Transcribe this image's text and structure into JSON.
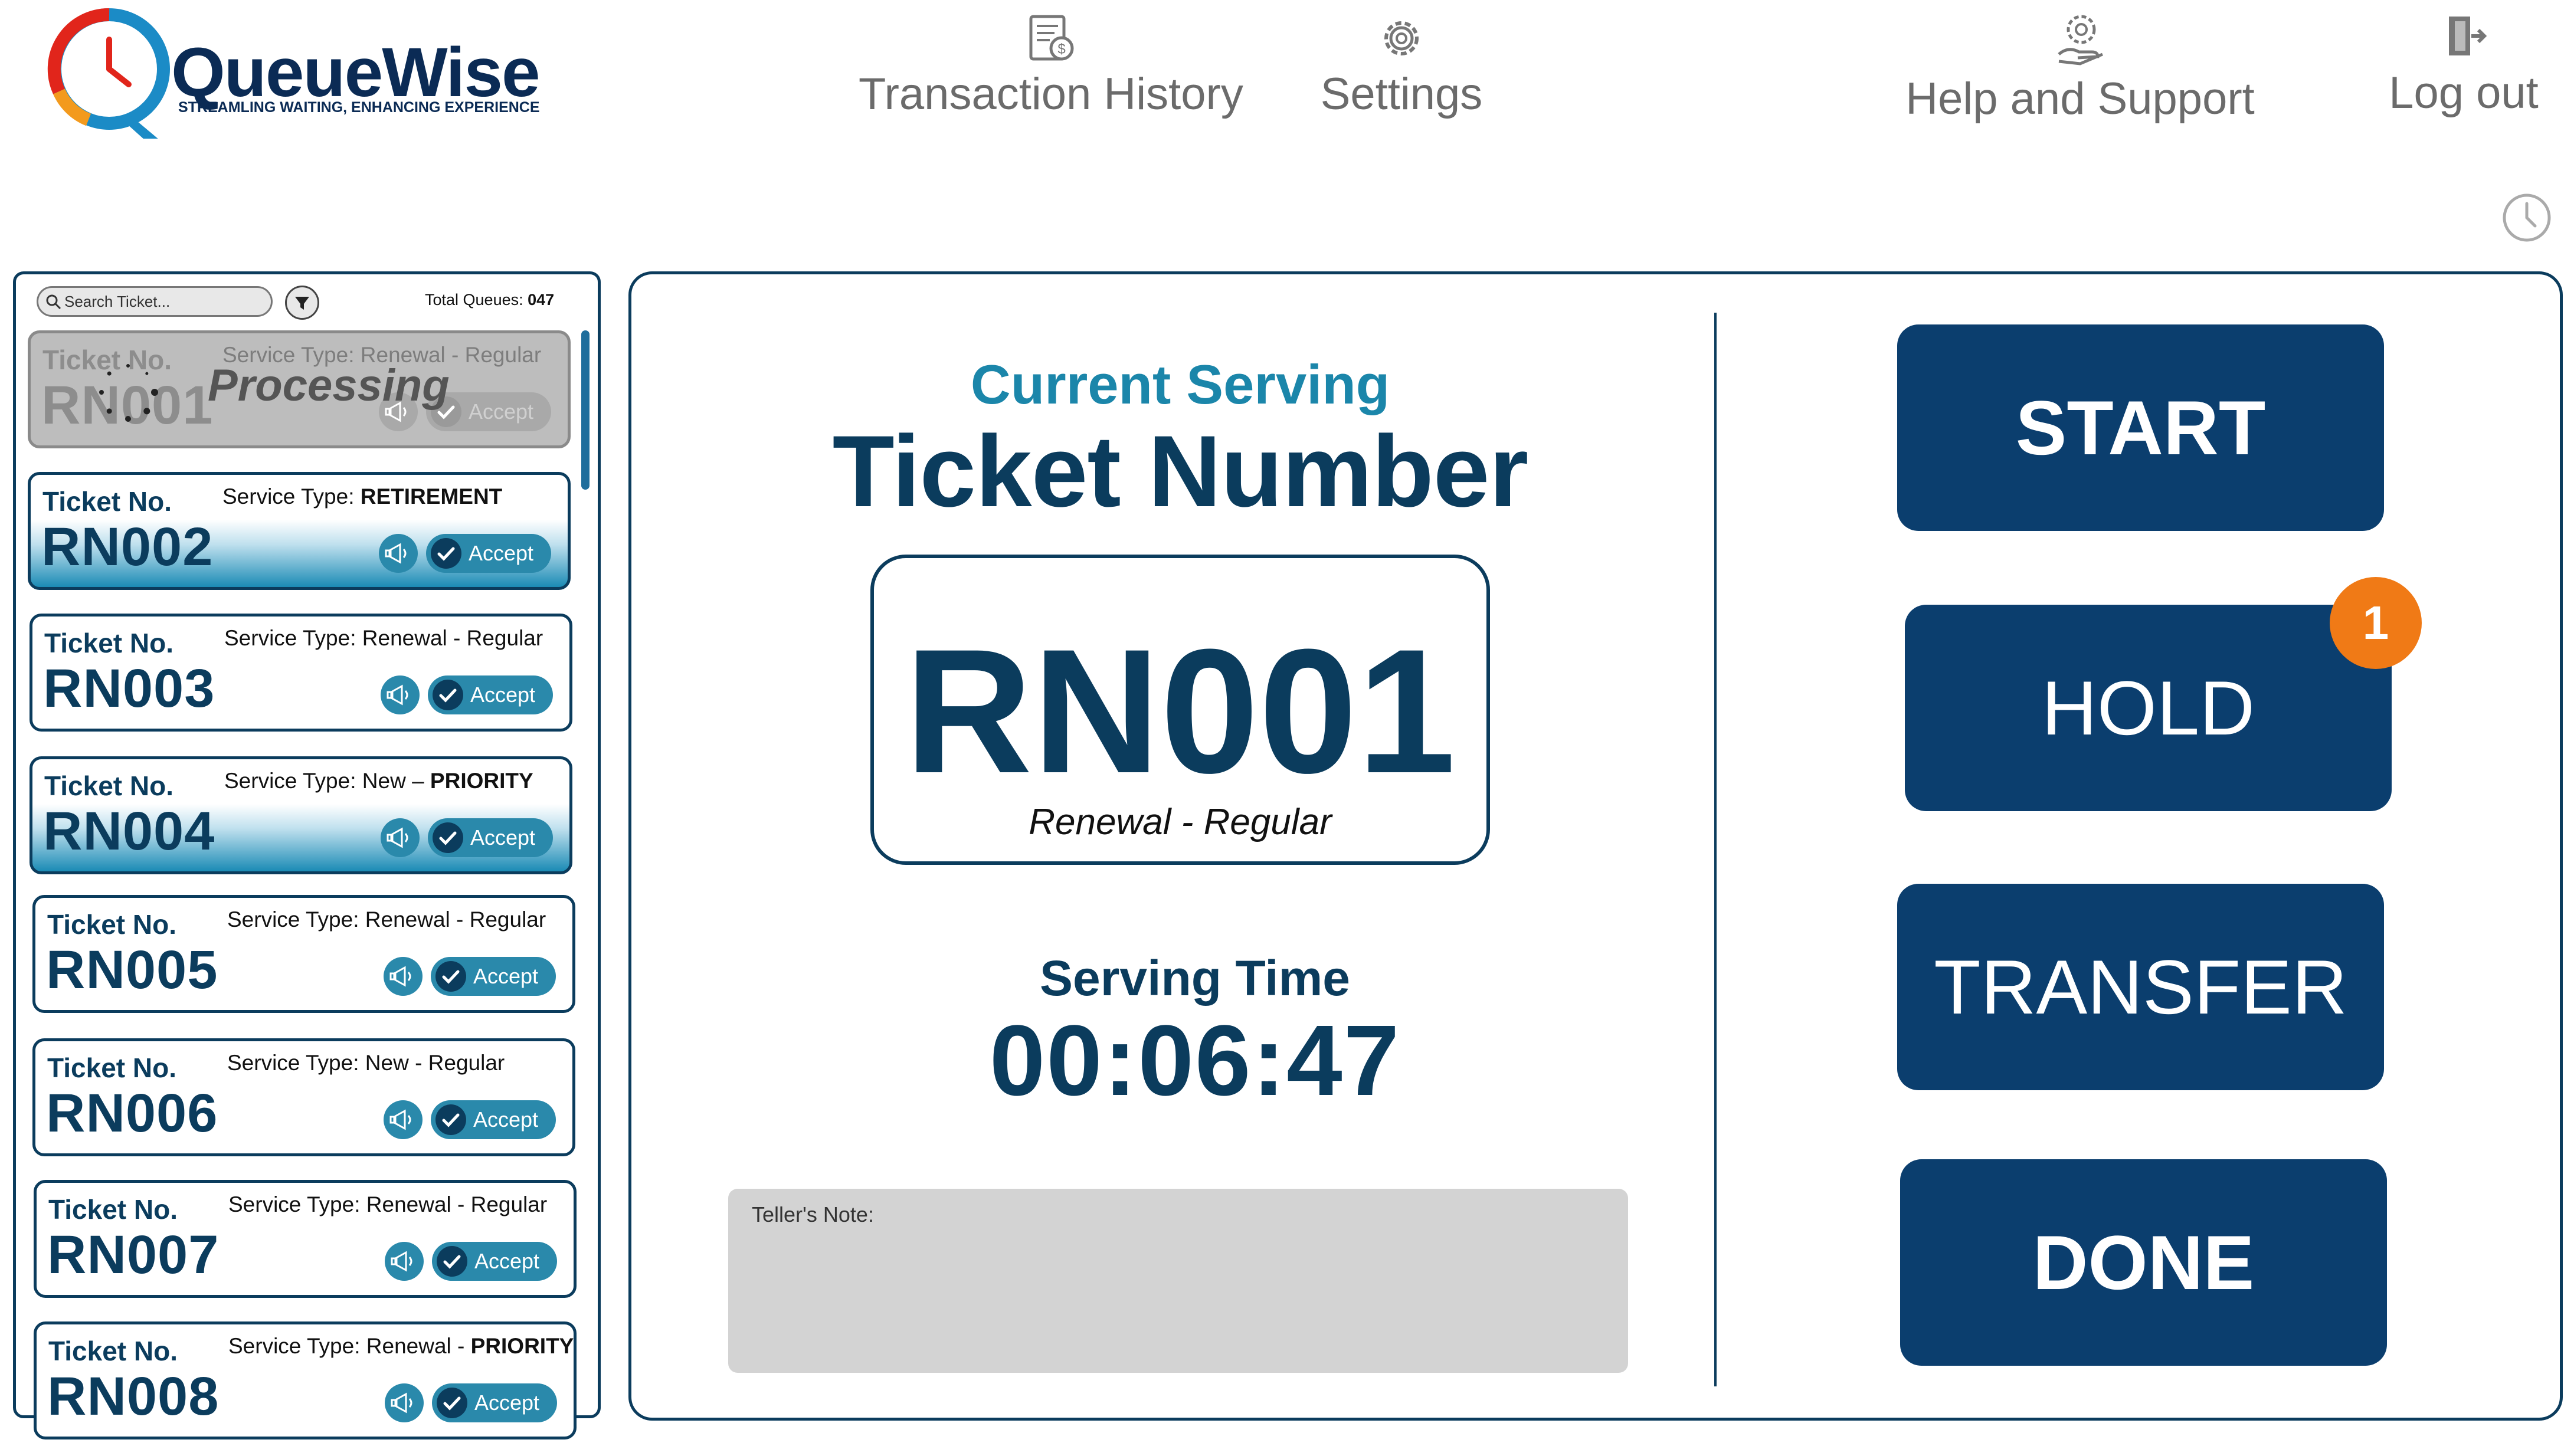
{
  "app": {
    "brand_name": "QueueWise",
    "tagline": "STREAMLING WAITING, ENHANCING EXPERIENCE"
  },
  "nav": {
    "transaction_history": "Transaction History",
    "settings": "Settings",
    "help_support": "Help and Support",
    "logout": "Log out"
  },
  "queue": {
    "search_placeholder": "Search Ticket...",
    "total_label": "Total Queues:",
    "total_value": "047",
    "processing_label": "Processing",
    "ticket_label": "Ticket No.",
    "service_prefix": "Service Type:",
    "accept_label": "Accept",
    "tickets": [
      {
        "number": "RN001",
        "service": "Renewal - Regular",
        "service_bold": "",
        "highlight": false,
        "processing": true
      },
      {
        "number": "RN002",
        "service": "",
        "service_bold": "RETIREMENT",
        "highlight": true,
        "processing": false
      },
      {
        "number": "RN003",
        "service": "Renewal - Regular",
        "service_bold": "",
        "highlight": false,
        "processing": false
      },
      {
        "number": "RN004",
        "service": "New – ",
        "service_bold": "PRIORITY",
        "highlight": true,
        "processing": false
      },
      {
        "number": "RN005",
        "service": "Renewal - Regular",
        "service_bold": "",
        "highlight": false,
        "processing": false
      },
      {
        "number": "RN006",
        "service": "New - Regular",
        "service_bold": "",
        "highlight": false,
        "processing": false
      },
      {
        "number": "RN007",
        "service": "Renewal - Regular",
        "service_bold": "",
        "highlight": false,
        "processing": false
      },
      {
        "number": "RN008",
        "service": "Renewal - ",
        "service_bold": "PRIORITY",
        "highlight": false,
        "processing": false
      }
    ]
  },
  "current": {
    "label": "Current Serving",
    "title": "Ticket Number",
    "ticket_number": "RN001",
    "service": "Renewal - Regular",
    "serving_time_label": "Serving Time",
    "serving_time": "00:06:47",
    "note_label": "Teller's Note:"
  },
  "actions": {
    "start": "START",
    "hold": "HOLD",
    "hold_count": "1",
    "transfer": "TRANSFER",
    "done": "DONE"
  },
  "colors": {
    "primary": "#0b3e6e",
    "accent": "#1b86aa",
    "badge": "#f07a16"
  }
}
